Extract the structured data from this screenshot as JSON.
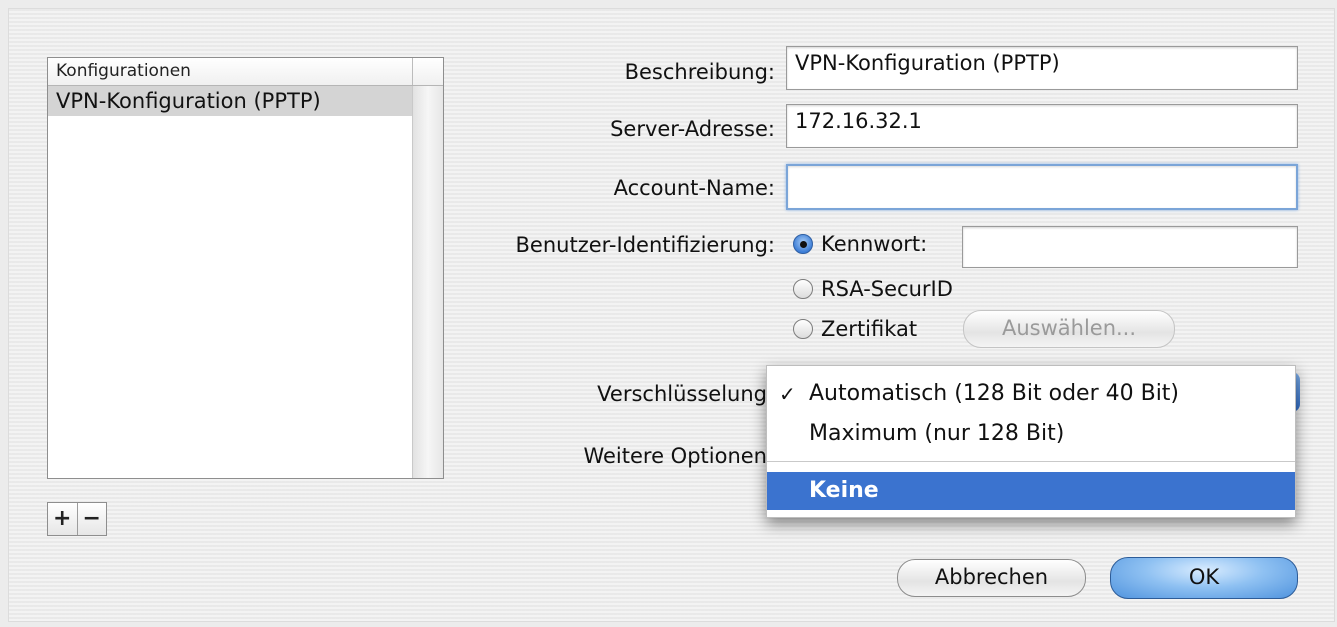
{
  "config_list": {
    "header": "Konfigurationen",
    "rows": [
      "VPN-Konfiguration (PPTP)"
    ],
    "add_label": "+",
    "remove_label": "−"
  },
  "form": {
    "beschreibung_label": "Beschreibung:",
    "beschreibung_value": "VPN-Konfiguration (PPTP)",
    "server_label": "Server-Adresse:",
    "server_value": "172.16.32.1",
    "account_label": "Account-Name:",
    "account_value": "",
    "auth_label": "Benutzer-Identifizierung:",
    "auth_options": [
      {
        "label": "Kennwort:",
        "selected": true
      },
      {
        "label": "RSA-SecurID",
        "selected": false
      },
      {
        "label": "Zertifikat",
        "selected": false
      }
    ],
    "password_value": "",
    "choose_label": "Auswählen...",
    "encryption_label": "Verschlüsselung",
    "more_options_label": "Weitere Optionen"
  },
  "encryption_menu": {
    "items": [
      {
        "label": "Automatisch (128 Bit oder 40 Bit)",
        "checked": true
      },
      {
        "label": "Maximum (nur 128 Bit)",
        "checked": false
      },
      {
        "label": "Keine",
        "highlighted": true
      }
    ]
  },
  "footer": {
    "cancel_label": "Abbrechen",
    "ok_label": "OK"
  },
  "colors": {
    "selection_blue": "#3b73cf",
    "focus_ring": "#7ba5d8"
  }
}
